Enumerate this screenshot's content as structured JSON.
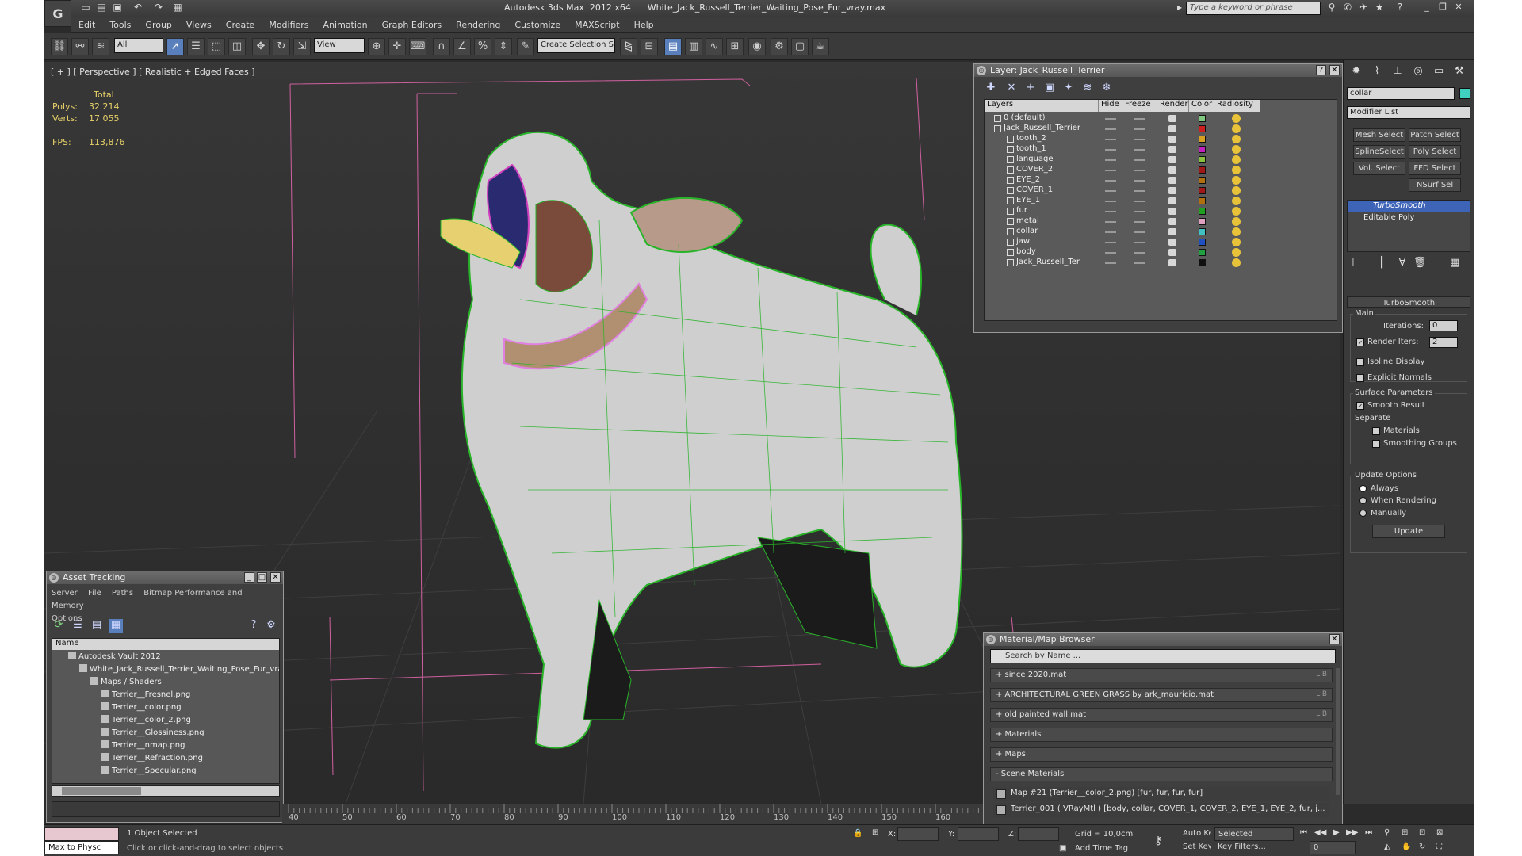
{
  "window": {
    "app_logo": "G",
    "title": "Autodesk 3ds Max  2012 x64      White_Jack_Russell_Terrier_Waiting_Pose_Fur_vray.max",
    "search_placeholder": "Type a keyword or phrase"
  },
  "menu": [
    "Edit",
    "Tools",
    "Group",
    "Views",
    "Create",
    "Modifiers",
    "Animation",
    "Graph Editors",
    "Rendering",
    "Customize",
    "MAXScript",
    "Help"
  ],
  "toolbar": {
    "selection_filter": "All",
    "ref_coord": "View",
    "named_selection": "Create Selection Se"
  },
  "viewport": {
    "label": "[ + ] [ Perspective ] [ Realistic + Edged Faces ]",
    "stats": {
      "total_label": "Total",
      "polys_label": "Polys:",
      "polys_value": "32 214",
      "verts_label": "Verts:",
      "verts_value": "17 055",
      "fps_label": "FPS:",
      "fps_value": "113,876"
    }
  },
  "layer_window": {
    "title": "Layer: Jack_Russell_Terrier",
    "columns": [
      "Layers",
      "Hide",
      "Freeze",
      "Render",
      "Color",
      "Radiosity"
    ],
    "layers": [
      {
        "name": "0 (default)",
        "color": "#7fc87f",
        "indent": 1
      },
      {
        "name": "Jack_Russell_Terrier",
        "color": "#cc2020",
        "indent": 1
      },
      {
        "name": "tooth_2",
        "color": "#d8a020",
        "indent": 2
      },
      {
        "name": "tooth_1",
        "color": "#c020c0",
        "indent": 2
      },
      {
        "name": "language",
        "color": "#88c040",
        "indent": 2
      },
      {
        "name": "COVER_2",
        "color": "#a01818",
        "indent": 2
      },
      {
        "name": "EYE_2",
        "color": "#b07010",
        "indent": 2
      },
      {
        "name": "COVER_1",
        "color": "#a01818",
        "indent": 2
      },
      {
        "name": "EYE_1",
        "color": "#b07010",
        "indent": 2
      },
      {
        "name": "fur",
        "color": "#20a020",
        "indent": 2
      },
      {
        "name": "metal",
        "color": "#e0a0c0",
        "indent": 2
      },
      {
        "name": "collar",
        "color": "#40c0c0",
        "indent": 2
      },
      {
        "name": "jaw",
        "color": "#2050c0",
        "indent": 2
      },
      {
        "name": "body",
        "color": "#20a040",
        "indent": 2
      },
      {
        "name": "Jack_Russell_Ter",
        "color": "#101010",
        "indent": 2
      }
    ]
  },
  "command_panel": {
    "object_name": "collar",
    "object_color": "#40d0c0",
    "modifier_list": "Modifier List",
    "buttons": [
      "Mesh Select",
      "Patch Select",
      "SplineSelect",
      "Poly Select",
      "Vol. Select",
      "FFD Select",
      "NSurf Sel"
    ],
    "stack": [
      "TurboSmooth",
      "Editable Poly"
    ],
    "rollout_title": "TurboSmooth",
    "main_label": "Main",
    "iterations_label": "Iterations:",
    "iterations_value": "0",
    "render_iters_label": "Render Iters:",
    "render_iters_value": "2",
    "isoline_label": "Isoline Display",
    "explicit_label": "Explicit Normals",
    "surface_label": "Surface Parameters",
    "smooth_label": "Smooth Result",
    "separate_label": "Separate",
    "materials_label": "Materials",
    "smoothing_label": "Smoothing Groups",
    "update_label": "Update Options",
    "always_label": "Always",
    "when_render_label": "When Rendering",
    "manually_label": "Manually",
    "update_button": "Update"
  },
  "asset_tracking": {
    "title": "Asset Tracking",
    "menu": [
      "Server",
      "File",
      "Paths",
      "Bitmap Performance and Memory",
      "Options"
    ],
    "column": "Name",
    "rows": [
      {
        "text": "Autodesk Vault 2012",
        "indent": 1
      },
      {
        "text": "White_Jack_Russell_Terrier_Waiting_Pose_Fur_vray",
        "indent": 2
      },
      {
        "text": "Maps / Shaders",
        "indent": 3
      },
      {
        "text": "Terrier__Fresnel.png",
        "indent": 4
      },
      {
        "text": "Terrier__color.png",
        "indent": 4
      },
      {
        "text": "Terrier__color_2.png",
        "indent": 4
      },
      {
        "text": "Terrier__Glossiness.png",
        "indent": 4
      },
      {
        "text": "Terrier__nmap.png",
        "indent": 4
      },
      {
        "text": "Terrier__Refraction.png",
        "indent": 4
      },
      {
        "text": "Terrier__Specular.png",
        "indent": 4
      }
    ]
  },
  "material_browser": {
    "title": "Material/Map Browser",
    "search_placeholder": "Search by Name ...",
    "libraries": [
      {
        "text": "+ since 2020.mat",
        "lib": "LIB"
      },
      {
        "text": "+ ARCHITECTURAL GREEN GRASS by ark_mauricio.mat",
        "lib": "LIB"
      },
      {
        "text": "+ old painted wall.mat",
        "lib": "LIB"
      },
      {
        "text": "+ Materials",
        "lib": ""
      },
      {
        "text": "+ Maps",
        "lib": ""
      },
      {
        "text": "- Scene Materials",
        "lib": ""
      }
    ],
    "scene_items": [
      "Map #21 (Terrier__color_2.png)  [fur, fur, fur, fur]",
      "Terrier_001  ( VRayMtl )  [body, collar, COVER_1, COVER_2, EYE_1, EYE_2, fur, j..."
    ]
  },
  "timeline": {
    "ticks": [
      "40",
      "50",
      "60",
      "70",
      "80",
      "90",
      "100",
      "110",
      "120",
      "130",
      "140",
      "150",
      "160"
    ]
  },
  "status": {
    "maxscript_label": "Max to Physc",
    "selection_info": "1 Object Selected",
    "prompt": "Click or click-and-drag to select objects",
    "x_label": "X:",
    "y_label": "Y:",
    "z_label": "Z:",
    "grid": "Grid = 10,0cm",
    "add_time_tag": "Add Time Tag",
    "auto_key": "Auto Key",
    "set_key": "Set Key",
    "key_mode": "Selected",
    "key_filters": "Key Filters...",
    "frame": "0"
  }
}
